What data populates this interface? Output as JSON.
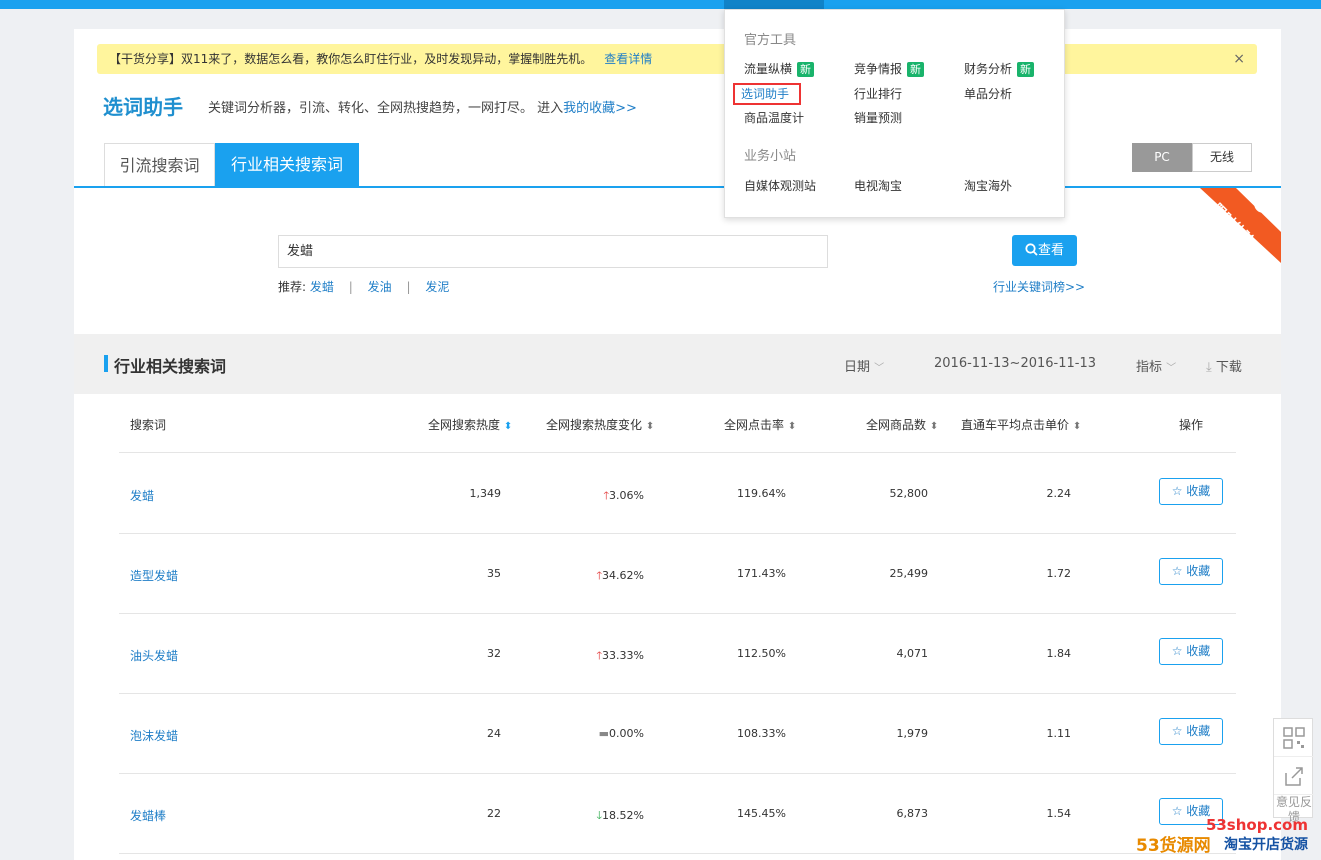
{
  "notice": {
    "text": "【干货分享】双11来了，数据怎么看，教你怎么盯住行业，及时发现异动，掌握制胜先机。",
    "link": "查看详情",
    "close": "×"
  },
  "header": {
    "title": "选词助手",
    "subtitle": "关键词分析器，引流、转化、全网热搜趋势，一网打尽。 进入",
    "fav_link": "我的收藏>>"
  },
  "tabs": [
    "引流搜索词",
    "行业相关搜索词"
  ],
  "device": {
    "pc": "PC",
    "wireless": "无线"
  },
  "ribbon": {
    "text": "限时体验",
    "color": "#f25a22"
  },
  "search": {
    "value": "发蜡",
    "button": "查看"
  },
  "recommend": {
    "label": "推荐:",
    "items": [
      "发蜡",
      "发油",
      "发泥"
    ]
  },
  "hot_link": "行业关键词榜>>",
  "section": {
    "title": "行业相关搜索词",
    "date_label": "日期",
    "date_range": "2016-11-13~2016-11-13",
    "metric_label": "指标",
    "download_label": "下载"
  },
  "table": {
    "headers": [
      "搜索词",
      "全网搜索热度",
      "全网搜索热度变化",
      "全网点击率",
      "全网商品数",
      "直通车平均点击单价",
      "操作"
    ],
    "fav_label": "收藏",
    "rows": [
      {
        "keyword": "发蜡",
        "heat": "1,349",
        "change": "3.06%",
        "trend": "up",
        "ctr": "119.64%",
        "items": "52,800",
        "cpc": "2.24"
      },
      {
        "keyword": "造型发蜡",
        "heat": "35",
        "change": "34.62%",
        "trend": "up",
        "ctr": "171.43%",
        "items": "25,499",
        "cpc": "1.72"
      },
      {
        "keyword": "油头发蜡",
        "heat": "32",
        "change": "33.33%",
        "trend": "up",
        "ctr": "112.50%",
        "items": "4,071",
        "cpc": "1.84"
      },
      {
        "keyword": "泡沫发蜡",
        "heat": "24",
        "change": "0.00%",
        "trend": "flat",
        "ctr": "108.33%",
        "items": "1,979",
        "cpc": "1.11"
      },
      {
        "keyword": "发蜡棒",
        "heat": "22",
        "change": "18.52%",
        "trend": "down",
        "ctr": "145.45%",
        "items": "6,873",
        "cpc": "1.54"
      }
    ]
  },
  "dropdown": {
    "group1": "官方工具",
    "group1_items": [
      {
        "label": "流量纵横",
        "new": "新"
      },
      {
        "label": "竞争情报",
        "new": "新"
      },
      {
        "label": "财务分析",
        "new": "新"
      },
      {
        "label": "选词助手",
        "new": ""
      },
      {
        "label": "行业排行",
        "new": ""
      },
      {
        "label": "单品分析",
        "new": ""
      },
      {
        "label": "商品温度计",
        "new": ""
      },
      {
        "label": "销量预测",
        "new": ""
      }
    ],
    "group2": "业务小站",
    "group2_items": [
      "自媒体观测站",
      "电视淘宝",
      "淘宝海外"
    ]
  },
  "side_tools": {
    "feedback": "意见反馈"
  },
  "watermark": {
    "url": "53shop.com",
    "brand": "53货源网",
    "tagline": "淘宝开店货源"
  }
}
